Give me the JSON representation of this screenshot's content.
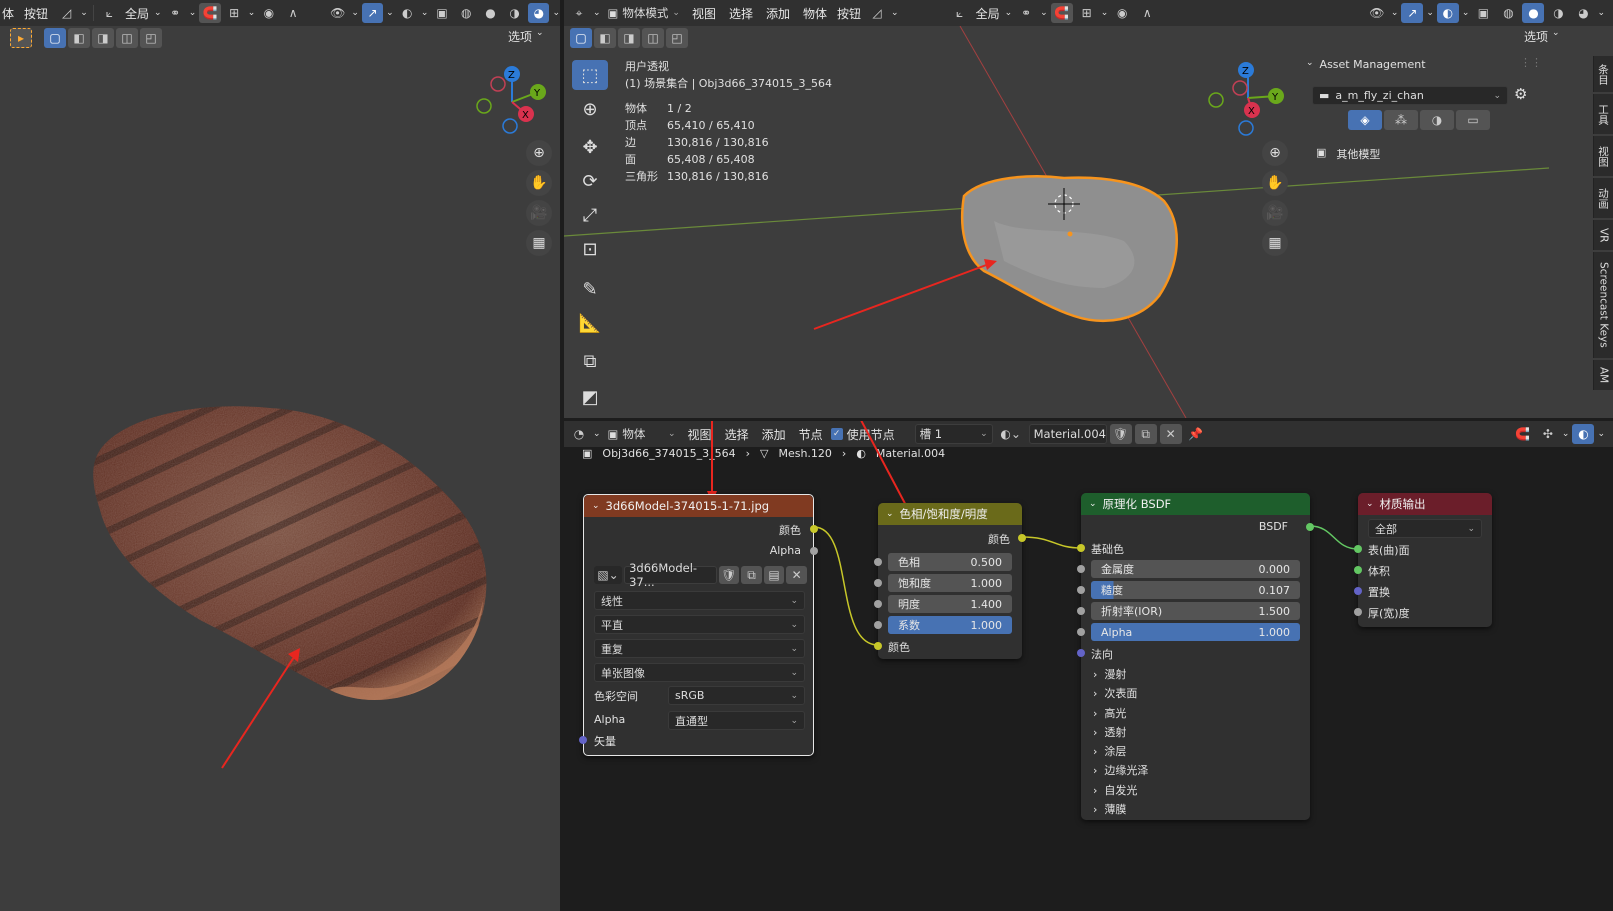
{
  "left_viewport": {
    "header": [
      "体",
      "按钮"
    ],
    "transform": "全局",
    "options": "选项"
  },
  "right_viewport": {
    "mode": "物体模式",
    "menus": [
      "视图",
      "选择",
      "添加",
      "物体",
      "按钮"
    ],
    "transform": "全局",
    "options": "选项",
    "overlay_title": "用户透视",
    "overlay_scene": "(1) 场景集合 | Obj3d66_374015_3_564",
    "stats": [
      {
        "k": "物体",
        "v": "1 / 2"
      },
      {
        "k": "顶点",
        "v": "65,410 / 65,410"
      },
      {
        "k": "边",
        "v": "130,816 / 130,816"
      },
      {
        "k": "面",
        "v": "65,408 / 65,408"
      },
      {
        "k": "三角形",
        "v": "130,816 / 130,816"
      }
    ],
    "gizmo": {
      "x": "X",
      "y": "Y",
      "z": "Z"
    }
  },
  "asset_panel": {
    "title": "Asset Management",
    "library": "a_m_fly_zi_chan",
    "item": "其他模型"
  },
  "side_tabs": [
    "条目",
    "工具",
    "视图",
    "动画",
    "VR",
    "Screencast Keys",
    "AM"
  ],
  "node_editor": {
    "mode": "物体",
    "menus": [
      "视图",
      "选择",
      "添加",
      "节点"
    ],
    "use_nodes": "使用节点",
    "slot": "槽 1",
    "material": "Material.004",
    "breadcrumb": [
      "Obj3d66_374015_3_564",
      "Mesh.120",
      "Material.004"
    ]
  },
  "node_image": {
    "title": "3d66Model-374015-1-71.jpg",
    "out_color": "颜色",
    "out_alpha": "Alpha",
    "image_name": "3d66Model-37...",
    "interpolation": "线性",
    "projection": "平直",
    "extension": "重复",
    "source": "单张图像",
    "colorspace_label": "色彩空间",
    "colorspace": "sRGB",
    "alpha_label": "Alpha",
    "alpha_mode": "直通型",
    "vector": "矢量"
  },
  "node_hsv": {
    "title": "色相/饱和度/明度",
    "out_color": "颜色",
    "hue_label": "色相",
    "hue": "0.500",
    "sat_label": "饱和度",
    "sat": "1.000",
    "val_label": "明度",
    "val": "1.400",
    "fac_label": "系数",
    "fac": "1.000",
    "in_color": "颜色"
  },
  "node_bsdf": {
    "title": "原理化 BSDF",
    "out": "BSDF",
    "base_color": "基础色",
    "metallic_label": "金属度",
    "metallic": "0.000",
    "roughness_label": "糙度",
    "roughness": "0.107",
    "ior_label": "折射率(IOR)",
    "ior": "1.500",
    "alpha_label": "Alpha",
    "alpha": "1.000",
    "normal": "法向",
    "sections": [
      "漫射",
      "次表面",
      "高光",
      "透射",
      "涂层",
      "边缘光泽",
      "自发光",
      "薄膜"
    ]
  },
  "node_output": {
    "title": "材质输出",
    "target": "全部",
    "surface": "表(曲)面",
    "volume": "体积",
    "displacement": "置换",
    "thickness": "厚(宽)度"
  }
}
